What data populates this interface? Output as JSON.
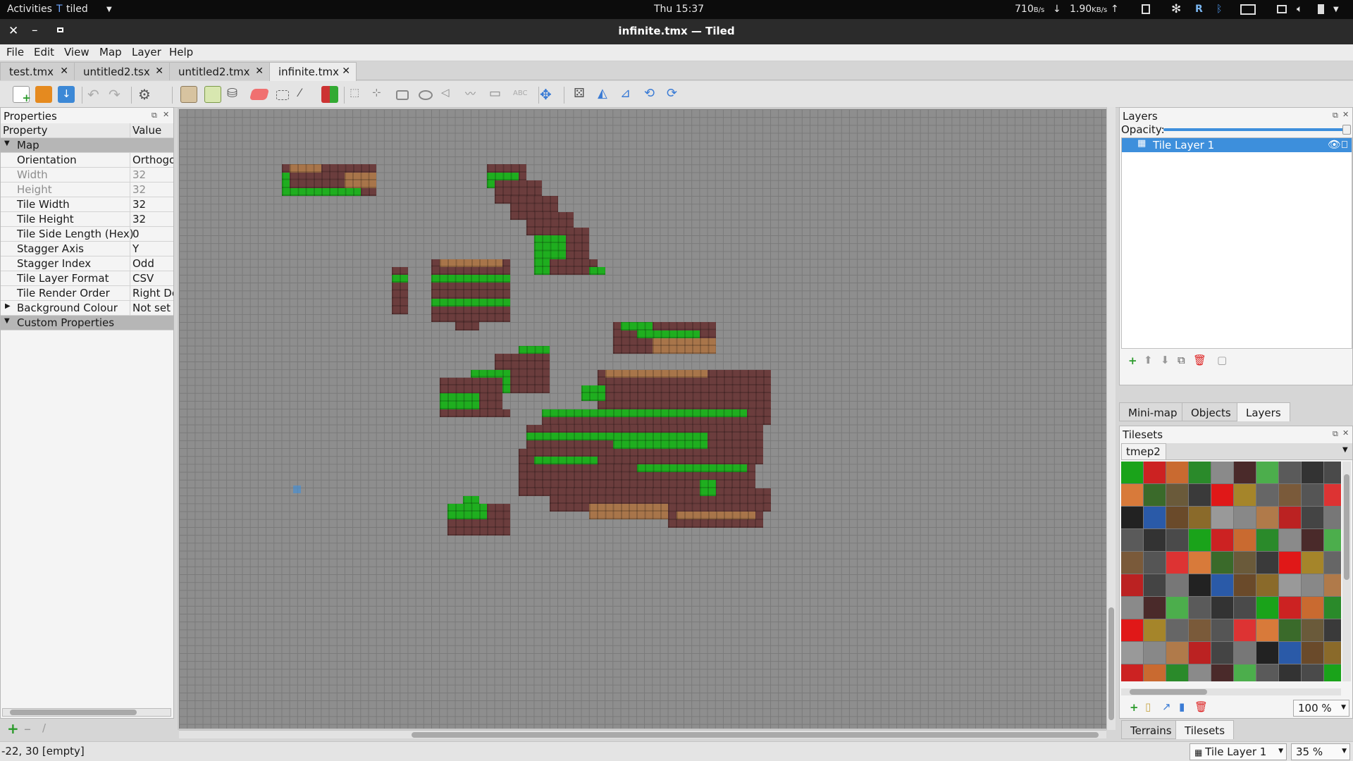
{
  "topbar": {
    "activities": "Activities",
    "app_menu": "tiled",
    "clock": "Thu 15:37",
    "net_down": "710",
    "net_down_unit": "B/s",
    "net_up": "1.90",
    "net_up_unit": "KB/s"
  },
  "window": {
    "title": "infinite.tmx — Tiled"
  },
  "menu": [
    "File",
    "Edit",
    "View",
    "Map",
    "Layer",
    "Help"
  ],
  "tabs": [
    {
      "label": "test.tmx"
    },
    {
      "label": "untitled2.tsx"
    },
    {
      "label": "untitled2.tmx"
    },
    {
      "label": "infinite.tmx"
    }
  ],
  "properties": {
    "title": "Properties",
    "col_property": "Property",
    "col_value": "Value",
    "group_map": "Map",
    "rows": [
      {
        "name": "Orientation",
        "value": "Orthogo",
        "disabled": false
      },
      {
        "name": "Width",
        "value": "32",
        "disabled": true
      },
      {
        "name": "Height",
        "value": "32",
        "disabled": true
      },
      {
        "name": "Tile Width",
        "value": "32",
        "disabled": false
      },
      {
        "name": "Tile Height",
        "value": "32",
        "disabled": false
      },
      {
        "name": "Tile Side Length (Hex)",
        "value": "0",
        "disabled": false
      },
      {
        "name": "Stagger Axis",
        "value": "Y",
        "disabled": false
      },
      {
        "name": "Stagger Index",
        "value": "Odd",
        "disabled": false
      },
      {
        "name": "Tile Layer Format",
        "value": "CSV",
        "disabled": false
      },
      {
        "name": "Tile Render Order",
        "value": "Right Do",
        "disabled": false
      },
      {
        "name": "Background Colour",
        "value": "Not set",
        "disabled": false
      }
    ],
    "group_custom": "Custom Properties"
  },
  "layers": {
    "title": "Layers",
    "opacity_label": "Opacity:",
    "opacity": 1.0,
    "items": [
      {
        "name": "Tile Layer 1",
        "visible": true
      }
    ]
  },
  "dock_tabs_top": [
    "Mini-map",
    "Objects",
    "Layers"
  ],
  "tilesets": {
    "title": "Tilesets",
    "current": "tmep2",
    "zoom": "100 %"
  },
  "dock_tabs_bottom": [
    "Terrains",
    "Tilesets"
  ],
  "status": {
    "position": "-22, 30 [empty]",
    "layer": "Tile Layer 1",
    "zoom": "35 %"
  },
  "colors": {
    "selection": "#3d8fdc",
    "grass": "#1fae1f",
    "dirt": "#a8754a",
    "brick": "#6b3d3d"
  }
}
